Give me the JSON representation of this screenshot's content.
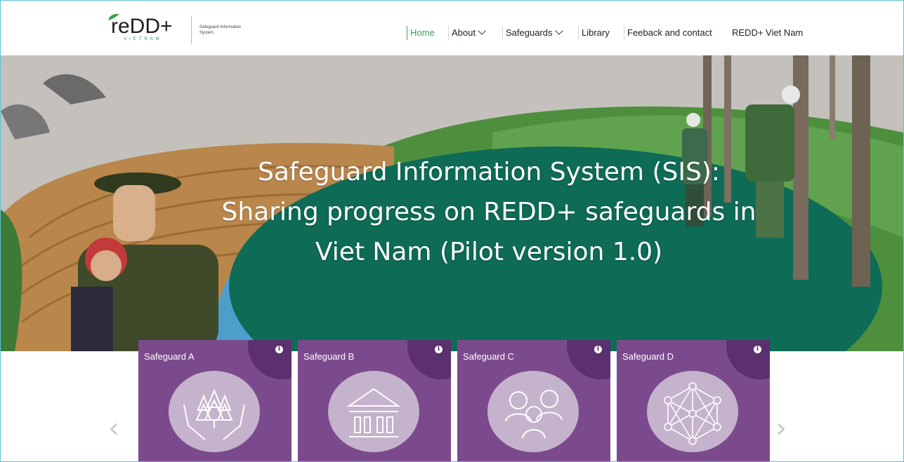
{
  "header": {
    "logo_text": "reDD+",
    "logo_country": "VIETNAM",
    "logo_tagline": "Safeguard Information System",
    "nav": [
      {
        "label": "Home",
        "active": true,
        "dropdown": false
      },
      {
        "label": "About",
        "active": false,
        "dropdown": true
      },
      {
        "label": "Safeguards",
        "active": false,
        "dropdown": true
      },
      {
        "label": "Library",
        "active": false,
        "dropdown": false
      },
      {
        "label": "Feeback and contact",
        "active": false,
        "dropdown": false
      },
      {
        "label": "REDD+ Viet Nam",
        "active": false,
        "dropdown": false
      }
    ]
  },
  "hero": {
    "title": "Safeguard Information System (SIS): Sharing progress on REDD+ safeguards in Viet Nam (Pilot version 1.0)"
  },
  "carousel": {
    "prev_icon": "chevron-left-icon",
    "next_icon": "chevron-right-icon",
    "cards": [
      {
        "label": "Safeguard A",
        "icon": "hands-trees-icon"
      },
      {
        "label": "Safeguard B",
        "icon": "institution-building-icon"
      },
      {
        "label": "Safeguard C",
        "icon": "people-group-icon"
      },
      {
        "label": "Safeguard D",
        "icon": "network-icon"
      }
    ]
  },
  "colors": {
    "card_bg": "#7b4a8c",
    "card_corner": "#5c2f6e",
    "nav_active": "#3aa14a",
    "hero_green": "#0e6b55"
  }
}
